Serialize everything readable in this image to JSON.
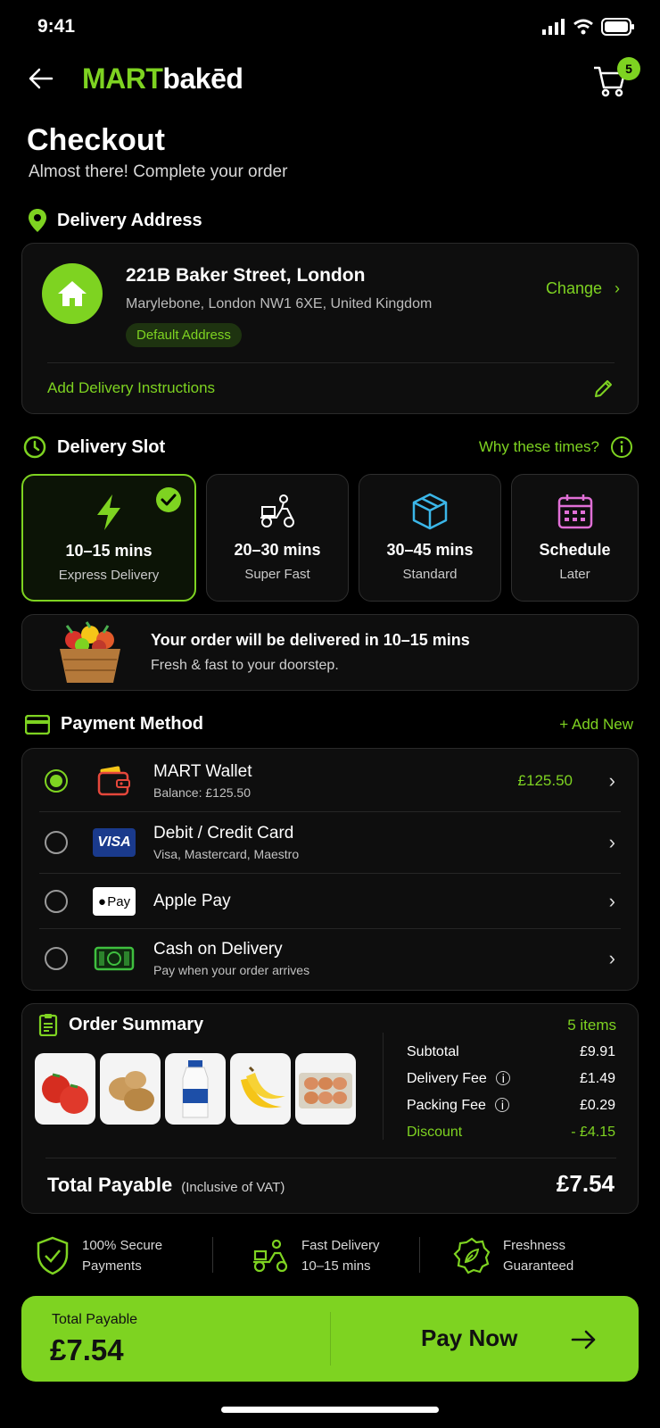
{
  "status_bar": {
    "time": "9:41"
  },
  "header": {
    "logo_part1": "MART",
    "logo_part2": "bakēd",
    "cart_count": "5"
  },
  "page": {
    "title": "Checkout",
    "subtitle": "Almost there! Complete your order"
  },
  "address": {
    "section_title": "Delivery Address",
    "line1": "221B Baker Street, London",
    "line2": "Marylebone, London NW1 6XE, United Kingdom",
    "badge": "Default Address",
    "change_label": "Change",
    "instructions_label": "Add Delivery Instructions"
  },
  "slots": {
    "section_title": "Delivery Slot",
    "why_label": "Why these times?",
    "items": [
      {
        "time": "10–15 mins",
        "label": "Express Delivery",
        "icon": "lightning-icon"
      },
      {
        "time": "20–30 mins",
        "label": "Super Fast",
        "icon": "scooter-icon"
      },
      {
        "time": "30–45 mins",
        "label": "Standard",
        "icon": "box-icon"
      },
      {
        "time": "Schedule",
        "label": "Later",
        "icon": "calendar-icon"
      }
    ],
    "info_title": "Your order will be delivered in 10–15 mins",
    "info_sub": "Fresh & fast to your doorstep."
  },
  "payment": {
    "section_title": "Payment Method",
    "add_label": "+ Add New",
    "methods": [
      {
        "title": "MART Wallet",
        "sub": "Balance: £125.50",
        "amount": "£125.50",
        "icon": "wallet-icon",
        "selected": true
      },
      {
        "title": "Debit / Credit Card",
        "sub": "Visa, Mastercard, Maestro",
        "icon": "visa-icon",
        "icon_text": "VISA"
      },
      {
        "title": "Apple Pay",
        "sub": "",
        "icon": "apple-pay-icon",
        "icon_text": "Pay"
      },
      {
        "title": "Cash on Delivery",
        "sub": "Pay when your order arrives",
        "icon": "cash-icon"
      }
    ]
  },
  "summary": {
    "section_title": "Order Summary",
    "items_count": "5 items",
    "products": [
      "tomatoes",
      "potatoes",
      "milk",
      "bananas",
      "eggs"
    ],
    "rows": [
      {
        "label": "Subtotal",
        "value": "£9.91"
      },
      {
        "label": "Delivery Fee",
        "value": "£1.49"
      },
      {
        "label": "Packing Fee",
        "value": "£0.29"
      },
      {
        "label": "Discount",
        "value": "- £4.15"
      }
    ],
    "total_label": "Total Payable",
    "total_note": "(Inclusive of VAT)",
    "total_value": "£7.54"
  },
  "trust": [
    {
      "line1": "100% Secure",
      "line2": "Payments"
    },
    {
      "line1": "Fast Delivery",
      "line2": "10–15 mins"
    },
    {
      "line1": "Freshness",
      "line2": "Guaranteed"
    }
  ],
  "footer": {
    "total_label": "Total Payable",
    "total_value": "£7.54",
    "pay_label": "Pay Now"
  },
  "colors": {
    "accent": "#7ed321",
    "background": "#000000",
    "card": "#0e0e0e"
  }
}
